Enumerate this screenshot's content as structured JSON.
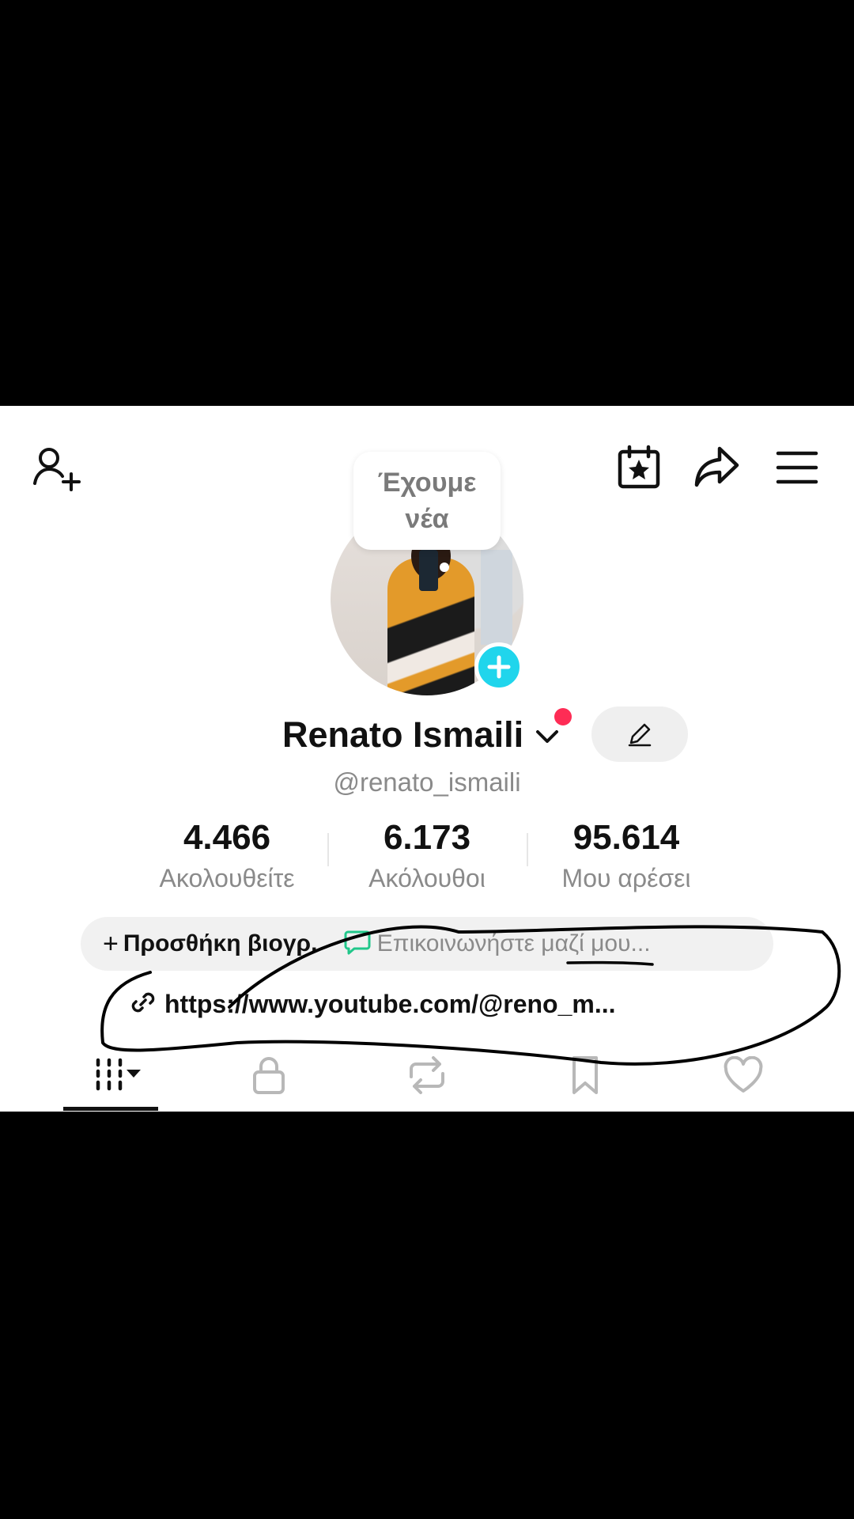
{
  "header": {
    "icons": [
      "add-user-icon",
      "calendar-star-icon",
      "share-icon",
      "menu-icon"
    ]
  },
  "news_bubble": {
    "text": "Έχουμε\nνέα"
  },
  "profile": {
    "name": "Renato Ismaili",
    "handle": "@renato_ismaili"
  },
  "stats": [
    {
      "value": "4.466",
      "label": "Ακολουθείτε"
    },
    {
      "value": "6.173",
      "label": "Ακόλουθοι"
    },
    {
      "value": "95.614",
      "label": "Μου αρέσει"
    }
  ],
  "bio": {
    "plus": "+",
    "add_bio": "Προσθήκη βιογρ.",
    "separator": "·",
    "contact": "Επικοινωνήστε μαζί μου..."
  },
  "link": {
    "text": "https://www.youtube.com/@reno_m..."
  },
  "tabs": [
    "videos",
    "private",
    "reposts",
    "saved",
    "liked"
  ],
  "colors": {
    "accent_cyan": "#20d5ec",
    "notify_red": "#fe2c55",
    "contact_green": "#21c78a"
  }
}
